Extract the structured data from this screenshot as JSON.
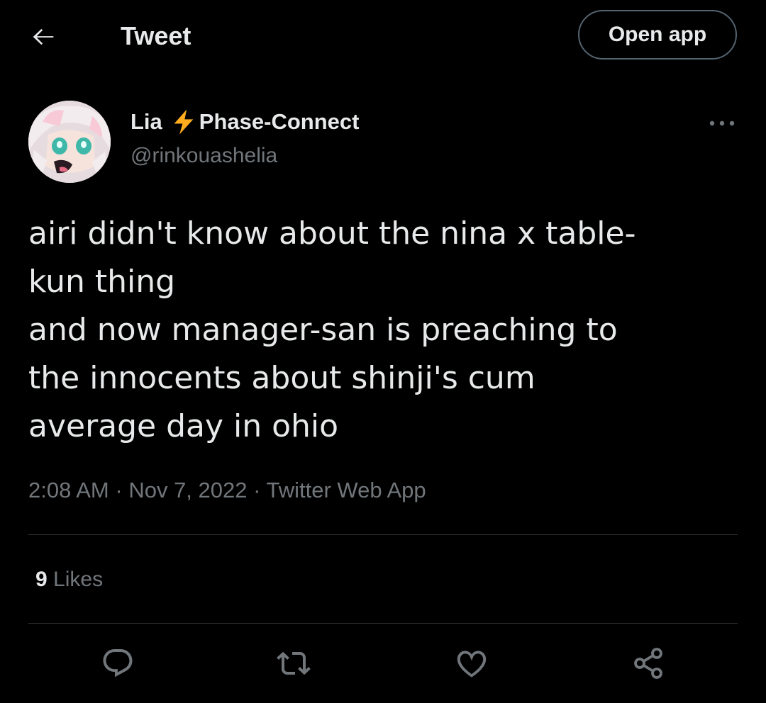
{
  "header": {
    "back_icon": "arrow-left-icon",
    "title": "Tweet",
    "open_app_label": "Open app"
  },
  "author": {
    "display_name": "Lia",
    "badge_icon": "lightning-bolt-icon",
    "affiliation": "Phase-Connect",
    "handle": "@rinkouashelia",
    "more_icon": "more-horizontal-icon"
  },
  "tweet": {
    "lines": [
      "airi didn't know about the nina x table-",
      "kun thing",
      "and now manager-san is preaching to",
      "the innocents about shinji's cum",
      "average day in ohio"
    ],
    "time": "2:08 AM",
    "separator": "·",
    "date": "Nov 7, 2022",
    "source": "Twitter Web App"
  },
  "stats": {
    "likes_count": "9",
    "likes_label": "Likes"
  },
  "actions": [
    {
      "icon": "reply-icon"
    },
    {
      "icon": "retweet-icon"
    },
    {
      "icon": "like-icon"
    },
    {
      "icon": "share-icon"
    }
  ],
  "colors": {
    "background": "#000000",
    "text_primary": "#e7e9ea",
    "text_secondary": "#71767b",
    "divider": "#2f3336",
    "bolt": "#ffad1f"
  }
}
